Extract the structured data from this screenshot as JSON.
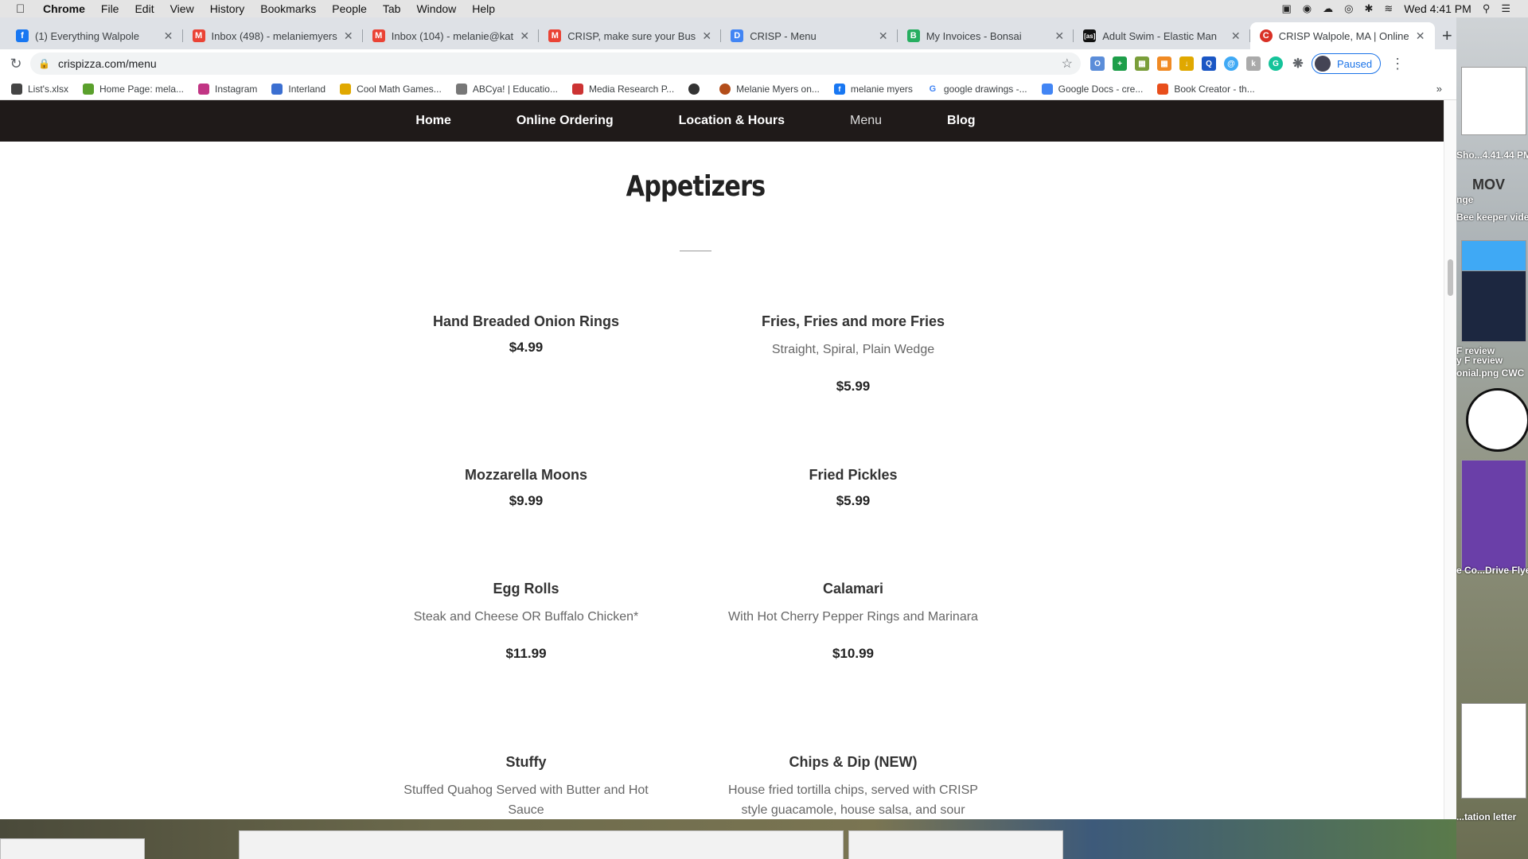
{
  "menubar": {
    "app": "Chrome",
    "menus": [
      "File",
      "Edit",
      "View",
      "History",
      "Bookmarks",
      "People",
      "Tab",
      "Window",
      "Help"
    ],
    "clock": "Wed 4:41 PM"
  },
  "tabs": [
    {
      "label": "(1) Everything Walpole",
      "icon_color": "#1877f2",
      "icon_letter": "f"
    },
    {
      "label": "Inbox (498) - melaniemyers",
      "icon_color": "#ea4335",
      "icon_letter": "M"
    },
    {
      "label": "Inbox (104) - melanie@kat",
      "icon_color": "#ea4335",
      "icon_letter": "M"
    },
    {
      "label": "CRISP, make sure your Bus",
      "icon_color": "#ea4335",
      "icon_letter": "M"
    },
    {
      "label": "CRISP - Menu",
      "icon_color": "#4285f4",
      "icon_letter": "D"
    },
    {
      "label": "My Invoices - Bonsai",
      "icon_color": "#27ae60",
      "icon_letter": "B"
    },
    {
      "label": "Adult Swim - Elastic Man",
      "icon_color": "#111111",
      "icon_letter": "as"
    },
    {
      "label": "CRISP Walpole, MA | Online",
      "icon_color": "#d93025",
      "icon_letter": "C"
    }
  ],
  "toolbar": {
    "url": "crispizza.com/menu",
    "profile_label": "Paused"
  },
  "bookmarks": [
    {
      "label": "List's.xlsx",
      "color": "#444444"
    },
    {
      "label": "Home Page: mela...",
      "color": "#5aa02c"
    },
    {
      "label": "Instagram",
      "color": "#c13584"
    },
    {
      "label": "Interland",
      "color": "#3b6fd1"
    },
    {
      "label": "Cool Math Games...",
      "color": "#e0a800"
    },
    {
      "label": "ABCya! | Educatio...",
      "color": "#777777"
    },
    {
      "label": "Media Research P...",
      "color": "#cc3333"
    },
    {
      "label": "",
      "color": "#333333"
    },
    {
      "label": "Melanie Myers on...",
      "color": "#b34d1a"
    },
    {
      "label": "melanie myers",
      "color": "#1877f2"
    },
    {
      "label": "google drawings -...",
      "color": "#4285f4"
    },
    {
      "label": "Google Docs - cre...",
      "color": "#4285f4"
    },
    {
      "label": "Book Creator - th...",
      "color": "#e84e1b"
    }
  ],
  "site": {
    "nav": [
      "Home",
      "Online Ordering",
      "Location & Hours",
      "Menu",
      "Blog"
    ],
    "section_title": "Appetizers",
    "items": [
      {
        "name": "Hand Breaded Onion Rings",
        "desc": "",
        "price": "$4.99"
      },
      {
        "name": "Fries, Fries and more Fries",
        "desc": "Straight, Spiral, Plain Wedge",
        "price": "$5.99"
      },
      {
        "name": "Mozzarella Moons",
        "desc": "",
        "price": "$9.99"
      },
      {
        "name": "Fried Pickles",
        "desc": "",
        "price": "$5.99"
      },
      {
        "name": "Egg Rolls",
        "desc": "Steak and Cheese OR Buffalo Chicken*",
        "price": "$11.99"
      },
      {
        "name": "Calamari",
        "desc": "With Hot Cherry Pepper Rings and Marinara",
        "price": "$10.99"
      },
      {
        "name": "Stuffy",
        "desc": "Stuffed Quahog Served with Butter and Hot Sauce",
        "price": ""
      },
      {
        "name": "Chips & Dip (NEW)",
        "desc": "House fried tortilla chips, served with CRISP style guacamole, house salsa, and sour cream.",
        "price": ""
      }
    ]
  },
  "desktop": {
    "labels": [
      "Sho...4.41.44 PM",
      "MOV",
      "nge",
      "Bee keeper vide",
      "F review",
      "y F review",
      "onial.png CWC",
      "e Co...Drive Flye",
      "...tation letter"
    ]
  }
}
